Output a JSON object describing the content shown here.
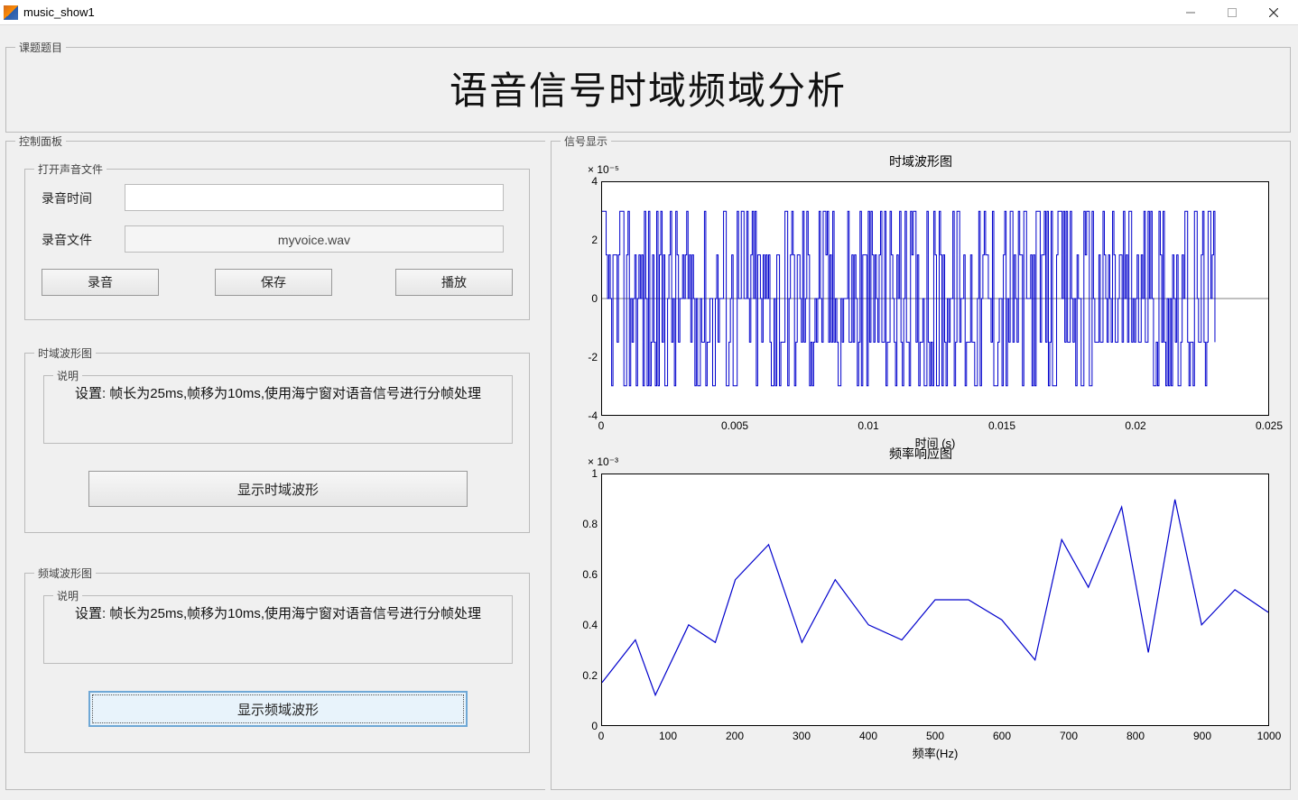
{
  "window": {
    "title": "music_show1"
  },
  "panels": {
    "title_legend": "课题题目",
    "big_title": "语音信号时域频域分析",
    "control_legend": "控制面板",
    "signal_legend": "信号显示"
  },
  "open_file": {
    "legend": "打开声音文件",
    "rec_time_label": "录音时间",
    "rec_time_value": "",
    "rec_file_label": "录音文件",
    "rec_file_value": "myvoice.wav",
    "btn_record": "录音",
    "btn_save": "保存",
    "btn_play": "播放"
  },
  "timepanel": {
    "legend": "时域波形图",
    "desc_legend": "说明",
    "desc": "设置: 帧长为25ms,帧移为10ms,使用海宁窗对语音信号进行分帧处理",
    "btn": "显示时域波形"
  },
  "freqpanel": {
    "legend": "频域波形图",
    "desc_legend": "说明",
    "desc": "设置: 帧长为25ms,帧移为10ms,使用海宁窗对语音信号进行分帧处理",
    "btn": "显示频域波形"
  },
  "chart_data": [
    {
      "type": "line",
      "title": "时域波形图",
      "xlabel": "时间 (s)",
      "ylabel": "",
      "xlim": [
        0,
        0.025
      ],
      "ylim": [
        -4e-05,
        4e-05
      ],
      "y_exponent": "× 10⁻⁵",
      "xticks": [
        0,
        0.005,
        0.01,
        0.015,
        0.02,
        0.025
      ],
      "yticks": [
        -4,
        -2,
        0,
        2,
        4
      ],
      "note": "dense quantized waveform oscillating between approx -3e-5 and +3e-5 over ~0 to 0.023 s"
    },
    {
      "type": "line",
      "title": "频率响应图",
      "xlabel": "频率(Hz)",
      "ylabel": "",
      "xlim": [
        0,
        1000
      ],
      "ylim": [
        0,
        0.001
      ],
      "y_exponent": "× 10⁻³",
      "xticks": [
        0,
        100,
        200,
        300,
        400,
        500,
        600,
        700,
        800,
        900,
        1000
      ],
      "yticks": [
        0,
        0.2,
        0.4,
        0.6,
        0.8,
        1
      ],
      "x": [
        0,
        50,
        80,
        130,
        170,
        200,
        250,
        300,
        350,
        400,
        450,
        500,
        550,
        600,
        650,
        690,
        730,
        780,
        820,
        860,
        900,
        950,
        1000
      ],
      "y": [
        0.17,
        0.34,
        0.12,
        0.4,
        0.33,
        0.58,
        0.72,
        0.33,
        0.58,
        0.4,
        0.34,
        0.5,
        0.5,
        0.42,
        0.26,
        0.74,
        0.55,
        0.87,
        0.29,
        0.9,
        0.4,
        0.54,
        0.45
      ]
    }
  ]
}
